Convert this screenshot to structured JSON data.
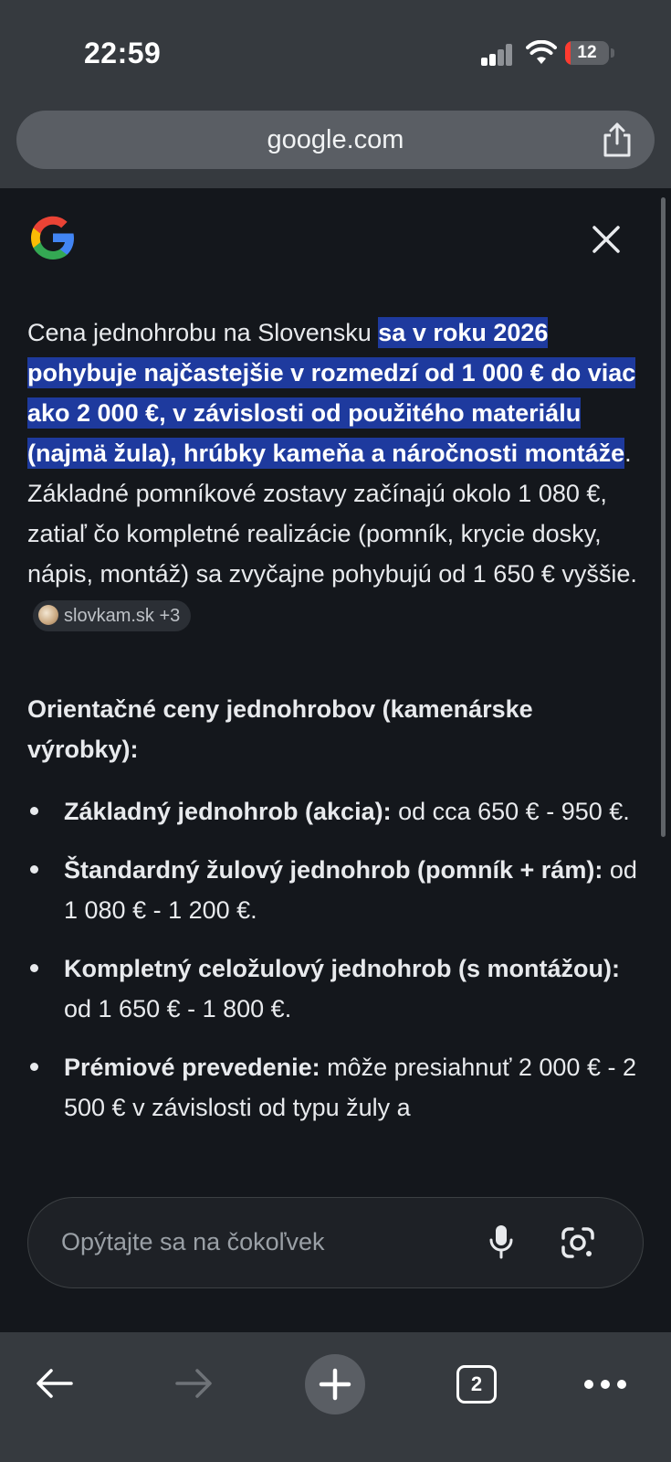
{
  "status_bar": {
    "time": "22:59",
    "battery_percent": "12",
    "battery_level": 0.12,
    "battery_color": "#ff3b30"
  },
  "browser": {
    "url": "google.com",
    "open_tabs": "2"
  },
  "icons": {
    "share": "share-icon",
    "google_logo": "google-g-logo",
    "close": "close-icon",
    "mic": "mic-icon",
    "lens": "google-lens-icon",
    "back": "back-arrow-icon",
    "forward": "forward-arrow-icon",
    "new_tab": "plus-icon",
    "more": "more-dots-icon"
  },
  "colors": {
    "highlight": "#1e3a9e",
    "page_bg": "#14171c",
    "chrome_bg": "#363a3f"
  },
  "answer": {
    "intro": "Cena jednohrobu na Slovensku ",
    "highlight": "sa v roku 2026 pohybuje najčastejšie v rozmedzí od 1 000 € do viac ako 2 000 €, v závislosti od použitého materiálu (najmä žula), hrúbky kameňa a náročnosti montáže",
    "rest": ". Základné pomníkové zostavy začínajú okolo 1 080 €, zatiaľ čo kompletné realizácie (pomník, krycie dosky, nápis, montáž) sa zvyčajne pohybujú od 1 650 € vyššie.",
    "source_chip": "slovkam.sk +3"
  },
  "section": {
    "title": "Orientačné ceny jednohrobov (kamenárske výrobky):",
    "items": [
      {
        "label": "Základný jednohrob (akcia):",
        "value": " od cca 650 € - 950 €."
      },
      {
        "label": "Štandardný žulový jednohrob (pomník + rám):",
        "value": " od 1 080 € - 1 200 €."
      },
      {
        "label": "Kompletný celožulový jednohrob (s montážou):",
        "value": " od 1 650 € - 1 800 €."
      },
      {
        "label": "Prémiové prevedenie:",
        "value": " môže presiahnuť 2 000 € - 2 500 € v závislosti od typu žuly a"
      }
    ]
  },
  "ask": {
    "placeholder": "Opýtajte sa na čokoľvek"
  }
}
